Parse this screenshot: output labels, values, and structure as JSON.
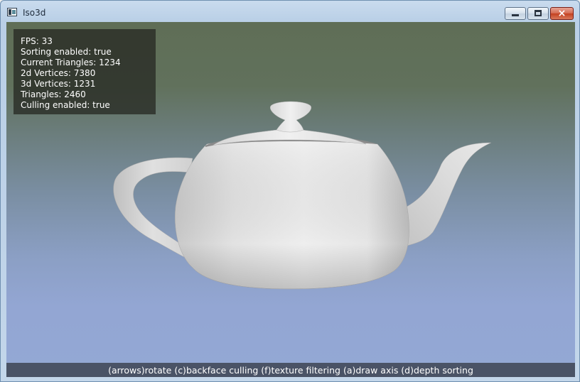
{
  "window": {
    "title": "Iso3d",
    "buttons": {
      "minimize": "minimize",
      "maximize": "maximize",
      "close": "×"
    }
  },
  "stats": {
    "fps": "FPS: 33",
    "sorting": "Sorting enabled: true",
    "current_triangles": "Current Triangles: 1234",
    "vertices_2d": "2d Vertices: 7380",
    "vertices_3d": "3d Vertices: 1231",
    "triangles": "Triangles: 2460",
    "culling": "Culling enabled: true"
  },
  "scene": {
    "object": "teapot"
  },
  "help": {
    "text": "(arrows)rotate (c)backface culling (f)texture filtering (a)draw axis (d)depth sorting"
  },
  "colors": {
    "background_top": "#5f6e56",
    "background_bottom": "#93a8d4",
    "overlay": "#2a2c24",
    "helpbar": "#4a5366"
  }
}
